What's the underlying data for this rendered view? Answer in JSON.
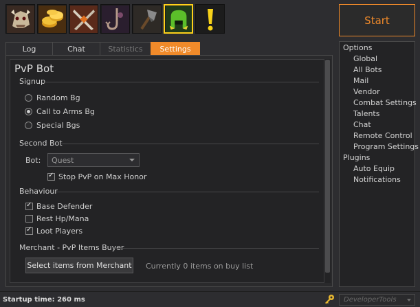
{
  "toolbar": {
    "icons": [
      {
        "name": "dragon-skull-icon"
      },
      {
        "name": "gold-coins-icon"
      },
      {
        "name": "crossed-swords-icon"
      },
      {
        "name": "fishing-hook-icon"
      },
      {
        "name": "axe-icon"
      },
      {
        "name": "pvp-helmet-icon",
        "active": true
      },
      {
        "name": "exclamation-icon"
      }
    ],
    "start_label": "Start"
  },
  "tabs": [
    {
      "label": "Log",
      "state": "normal"
    },
    {
      "label": "Chat",
      "state": "normal"
    },
    {
      "label": "Statistics",
      "state": "disabled"
    },
    {
      "label": "Settings",
      "state": "active"
    }
  ],
  "settings": {
    "title": "PvP Bot",
    "signup": {
      "label": "Signup",
      "options": [
        {
          "label": "Random Bg",
          "selected": false
        },
        {
          "label": "Call to Arms Bg",
          "selected": true
        },
        {
          "label": "Special Bgs",
          "selected": false
        }
      ]
    },
    "second_bot": {
      "label": "Second Bot",
      "bot_label": "Bot:",
      "bot_value": "Quest",
      "stop_pvp_label": "Stop PvP on Max Honor",
      "stop_pvp_checked": true
    },
    "behaviour": {
      "label": "Behaviour",
      "options": [
        {
          "label": "Base Defender",
          "checked": true
        },
        {
          "label": "Rest Hp/Mana",
          "checked": false
        },
        {
          "label": "Loot Players",
          "checked": true
        }
      ]
    },
    "merchant": {
      "label": "Merchant - PvP Items Buyer",
      "button_label": "Select items from Merchant",
      "status": "Currently 0 items on buy list"
    }
  },
  "tree": {
    "options_label": "Options",
    "options_items": [
      "Global",
      "All Bots",
      "Mail",
      "Vendor",
      "Combat Settings",
      "Talents",
      "Chat",
      "Remote Control",
      "Program Settings"
    ],
    "plugins_label": "Plugins",
    "plugins_items": [
      "Auto Equip",
      "Notifications"
    ]
  },
  "status": {
    "startup": "Startup time: 260 ms",
    "devtools": "DeveloperTools"
  },
  "colors": {
    "accent": "#f08a2a",
    "active_icon_border": "#ffd21a",
    "background": "#2d2d30"
  }
}
